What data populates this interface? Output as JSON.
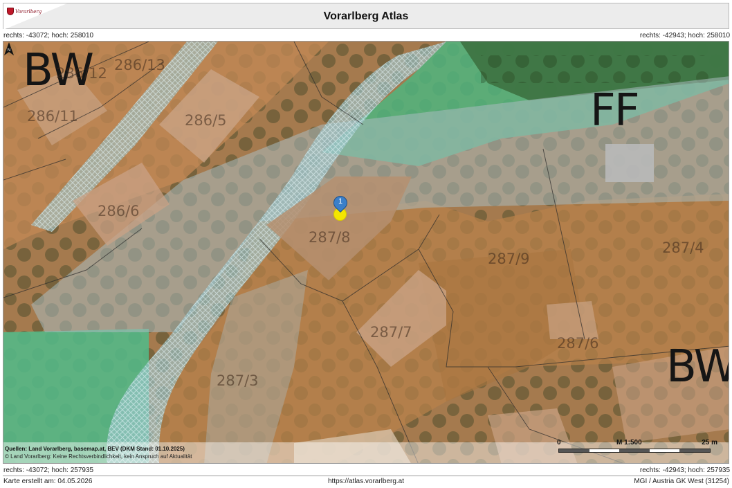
{
  "header": {
    "title": "Vorarlberg Atlas",
    "logo_text": "Vorarlberg"
  },
  "coordinates": {
    "top_left": "rechts: -43072; hoch: 258010",
    "top_right": "rechts: -42943; hoch: 258010",
    "bottom_left": "rechts: -43072; hoch: 257935",
    "bottom_right": "rechts: -42943; hoch: 257935"
  },
  "map": {
    "zone_labels": [
      "BW",
      "FF",
      "BW"
    ],
    "parcel_labels": [
      "286/12",
      "286/13",
      "286/11",
      "286/5",
      "286/6",
      "287/8",
      "287/9",
      "287/4",
      "287/7",
      "287/6",
      "287/3"
    ],
    "marker_number": "1",
    "marker_color": "#3b7fc9",
    "highlight_color": "#f4e600",
    "source_line1": "Quellen: Land Vorarlberg, basemap.at, BEV (DKM Stand: 01.10.2025)",
    "source_line2": "© Land Vorarlberg: Keine Rechtsverbindlichkeit, kein Anspruch auf Aktualität",
    "scale": {
      "start": "0",
      "ratio": "M 1:500",
      "end": "25 m"
    },
    "north_icon": "north-arrow-icon"
  },
  "footer": {
    "created": "Karte erstellt am: 04.05.2026",
    "url": "https://atlas.vorarlberg.at",
    "crs": "MGI / Austria GK West (31254)"
  }
}
